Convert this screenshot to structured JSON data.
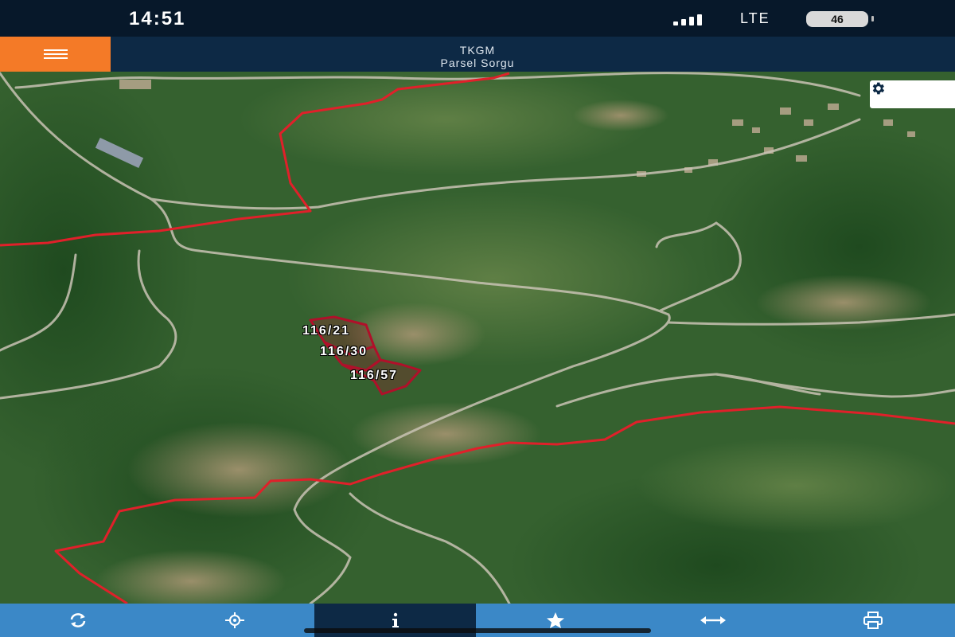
{
  "status_bar": {
    "time": "14:51",
    "network": "LTE",
    "battery": "46"
  },
  "header": {
    "title": "TKGM",
    "subtitle": "Parsel Sorgu",
    "menu_icon": "hamburger-icon",
    "accent_color": "#f47a27"
  },
  "map": {
    "settings_icon": "gear-icon",
    "parcels": [
      {
        "label": "116/21"
      },
      {
        "label": "116/30"
      },
      {
        "label": "116/57"
      }
    ],
    "boundary_color": "#e0202a",
    "parcel_color": "#b0102a"
  },
  "toolbar": {
    "items": [
      {
        "icon": "refresh-icon",
        "active": false
      },
      {
        "icon": "locate-crosshair-icon",
        "active": false
      },
      {
        "icon": "info-icon",
        "active": true
      },
      {
        "icon": "star-icon",
        "active": false
      },
      {
        "icon": "measure-arrows-icon",
        "active": false
      },
      {
        "icon": "print-icon",
        "active": false
      }
    ],
    "background_color": "#3b88c7"
  }
}
